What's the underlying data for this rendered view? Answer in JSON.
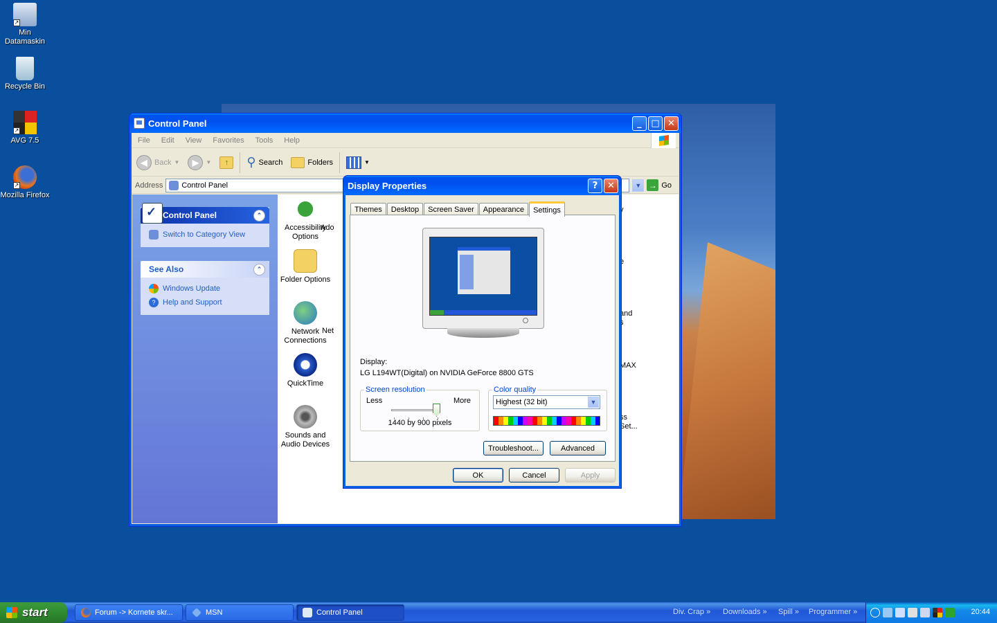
{
  "desktop": {
    "icons": [
      {
        "label_line1": "Min",
        "label_line2": "Datamaskin",
        "icon": "my-computer-icon"
      },
      {
        "label_line1": "Recycle Bin",
        "label_line2": "",
        "icon": "recycle-bin-icon"
      },
      {
        "label_line1": "AVG 7.5",
        "label_line2": "",
        "icon": "avg-icon"
      },
      {
        "label_line1": "Mozilla Firefox",
        "label_line2": "",
        "icon": "firefox-icon"
      }
    ]
  },
  "control_panel": {
    "title": "Control Panel",
    "menu": [
      "File",
      "Edit",
      "View",
      "Favorites",
      "Tools",
      "Help"
    ],
    "toolbar": {
      "back": "Back",
      "search": "Search",
      "folders": "Folders"
    },
    "address": {
      "label": "Address",
      "value": "Control Panel",
      "go": "Go"
    },
    "panel_main": {
      "title": "Control Panel",
      "link": "Switch to Category View"
    },
    "panel_see_also": {
      "title": "See Also",
      "links": [
        "Windows Update",
        "Help and Support"
      ]
    },
    "items": [
      {
        "line1": "Accessibility",
        "line2": "Options"
      },
      {
        "line1": "Ado",
        "line2": ""
      },
      {
        "line1": "Folder Options",
        "line2": ""
      },
      {
        "line1": "Network",
        "line2": "Connections"
      },
      {
        "line1": "Net",
        "line2": ""
      },
      {
        "line1": "QuickTime",
        "line2": ""
      },
      {
        "line1": "Sounds and",
        "line2": "Audio Devices"
      },
      {
        "line1": "y",
        "line2": ""
      },
      {
        "line1": "e",
        "line2": ""
      },
      {
        "line1": "and",
        "line2": "s"
      },
      {
        "line1": "MAX",
        "line2": ""
      },
      {
        "line1": "ss",
        "line2": "Set..."
      }
    ]
  },
  "display_properties": {
    "title": "Display Properties",
    "tabs": [
      "Themes",
      "Desktop",
      "Screen Saver",
      "Appearance",
      "Settings"
    ],
    "active_tab": "Settings",
    "display_label": "Display:",
    "display_value": "LG L194WT(Digital) on NVIDIA GeForce 8800 GTS",
    "resolution": {
      "legend": "Screen resolution",
      "less": "Less",
      "more": "More",
      "value": "1440 by 900 pixels",
      "slider_position": 1.0
    },
    "color_quality": {
      "legend": "Color quality",
      "selected": "Highest (32 bit)"
    },
    "buttons": {
      "troubleshoot": "Troubleshoot...",
      "advanced": "Advanced",
      "ok": "OK",
      "cancel": "Cancel",
      "apply": "Apply"
    }
  },
  "taskbar": {
    "start": "start",
    "tasks": [
      {
        "label": "Forum -> Kornete skr...",
        "active": false
      },
      {
        "label": "MSN",
        "active": false
      },
      {
        "label": "Control Panel",
        "active": true
      }
    ],
    "quick_links": [
      "Div. Crap",
      "Downloads",
      "Spill",
      "Programmer"
    ],
    "clock": "20:44"
  },
  "colors": {
    "desktop": "#0a4f9d",
    "titlebar": "#0053ee",
    "link": "#215dc6",
    "start_green": "#2f8b2f"
  }
}
